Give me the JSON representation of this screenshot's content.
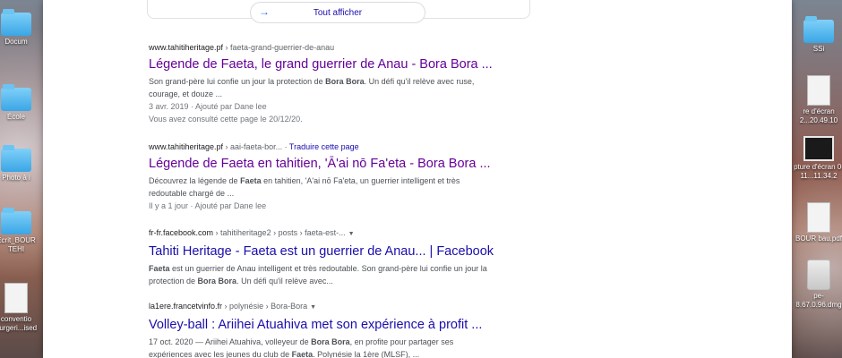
{
  "desktop": {
    "left_items": [
      {
        "label": "Docum",
        "kind": "folder"
      },
      {
        "label": "École",
        "kind": "folder"
      },
      {
        "label": "Photo à i",
        "kind": "folder"
      },
      {
        "label": "Écrit_BOUR TEHI",
        "kind": "folder"
      },
      {
        "label": "conventio ourgeri...ised",
        "kind": "doc"
      }
    ],
    "right_items": [
      {
        "label": "SSi",
        "kind": "folder"
      },
      {
        "label": "re d'écran 2...20.49.10",
        "kind": "doc"
      },
      {
        "label": "pture d'écran 0-11...11.34.2",
        "kind": "thumb"
      },
      {
        "label": "BOUR bau.pdf",
        "kind": "doc"
      },
      {
        "label": "pe-8.67.0.96.dmg",
        "kind": "dmg"
      }
    ]
  },
  "show_all": {
    "label": "Tout afficher"
  },
  "results": [
    {
      "domain": "www.tahitiheritage.pf",
      "path": " › faeta-grand-guerrier-de-anau",
      "translate": "",
      "title": "Légende de Faeta, le grand guerrier de Anau - Bora Bora ...",
      "visited": true,
      "snippet_lines": [
        [
          "Son grand-père lui confie un jour la protection de ",
          "Bora Bora",
          ". Un défi qu'il relève avec ruse,"
        ],
        [
          "courage, et douze ..."
        ]
      ],
      "meta_lines": [
        "3 avr. 2019 · Ajouté par Dane lee",
        "Vous avez consulté cette page le 20/12/20."
      ]
    },
    {
      "domain": "www.tahitiheritage.pf",
      "path": " › aai-faeta-bor... · ",
      "translate": "Traduire cette page",
      "title": "Légende de Faeta en tahitien, 'Ā'ai nō Fa'eta - Bora Bora ...",
      "visited": true,
      "snippet_lines": [
        [
          "Découvrez la légende de ",
          "Faeta",
          " en tahitien, 'A'ai nō Fa'eta, un guerrier intelligent et très"
        ],
        [
          "redoutable chargé de ..."
        ]
      ],
      "meta_lines": [
        "Il y a 1 jour · Ajouté par Dane lee"
      ]
    },
    {
      "domain": "fr-fr.facebook.com",
      "path": " › tahitiheritage2 › posts › faeta-est-...",
      "translate": "",
      "title": "Tahiti Heritage - Faeta est un guerrier de Anau... | Facebook",
      "visited": false,
      "snippet_lines": [
        [
          "",
          "Faeta",
          " est un guerrier de Anau intelligent et très redoutable. Son grand-père lui confie un jour la"
        ],
        [
          "protection de ",
          "Bora Bora",
          ". Un défi qu'il relève avec..."
        ]
      ],
      "meta_lines": []
    },
    {
      "domain": "la1ere.francetvinfo.fr",
      "path": " › polynésie › Bora-Bora",
      "translate": "",
      "title": "Volley-ball : Ariihei Atuahiva met son expérience à profit ...",
      "visited": false,
      "snippet_lines": [
        [
          "17 oct. 2020 — Ariihei Atuahiva, volleyeur de ",
          "Bora Bora",
          ", en profite pour partager ses"
        ],
        [
          "expériences avec les jeunes du club de ",
          "Faeta",
          ". Polynésie la 1ère (MLSF), ..."
        ]
      ],
      "meta_lines": []
    }
  ]
}
